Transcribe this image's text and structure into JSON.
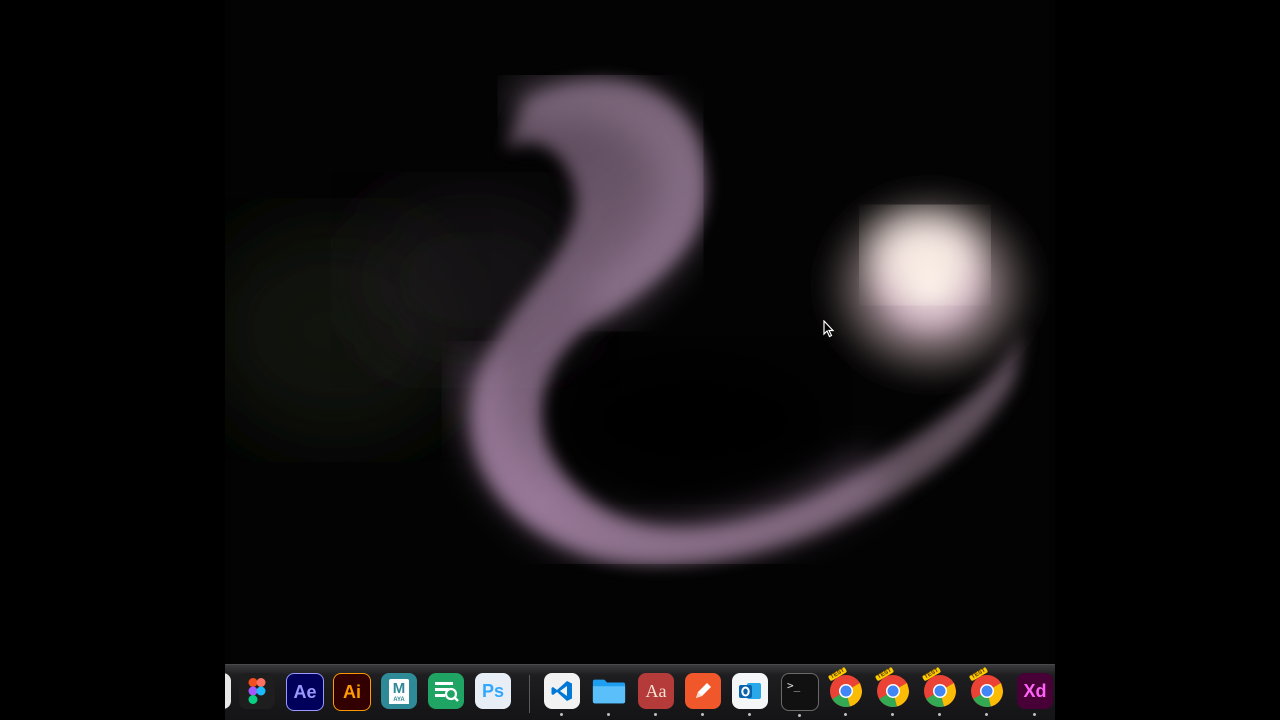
{
  "desktop": {
    "wallpaper": "purple smoke animation on black background",
    "colors": {
      "background": "#000000",
      "smoke_purple": "#c89ac8",
      "smoke_glow": "#ffe6f0",
      "dock_bg": "#1a1a1c"
    }
  },
  "dock": {
    "items": [
      {
        "name": "partial-app-icon",
        "label": ""
      },
      {
        "name": "figma-icon",
        "label": ""
      },
      {
        "name": "after-effects-icon",
        "label": "Ae"
      },
      {
        "name": "illustrator-icon",
        "label": "Ai"
      },
      {
        "name": "maya-icon",
        "label": "M",
        "sublabel": "AYA"
      },
      {
        "name": "spreadsheet-search-icon",
        "label": ""
      },
      {
        "name": "photoshop-icon",
        "label": "Ps"
      },
      {
        "name": "vscode-icon",
        "label": ""
      },
      {
        "name": "files-folder-icon",
        "label": ""
      },
      {
        "name": "dictionary-icon",
        "label": "Aa"
      },
      {
        "name": "pen-app-icon",
        "label": ""
      },
      {
        "name": "outlook-icon",
        "label": ""
      },
      {
        "name": "terminal-icon",
        "label": ">_"
      },
      {
        "name": "chrome-test-icon",
        "label": "TEST"
      },
      {
        "name": "chrome-test-icon",
        "label": "TEST"
      },
      {
        "name": "chrome-test-icon",
        "label": "TEST"
      },
      {
        "name": "chrome-test-icon",
        "label": "TEST"
      },
      {
        "name": "xd-icon",
        "label": "Xd"
      }
    ]
  }
}
